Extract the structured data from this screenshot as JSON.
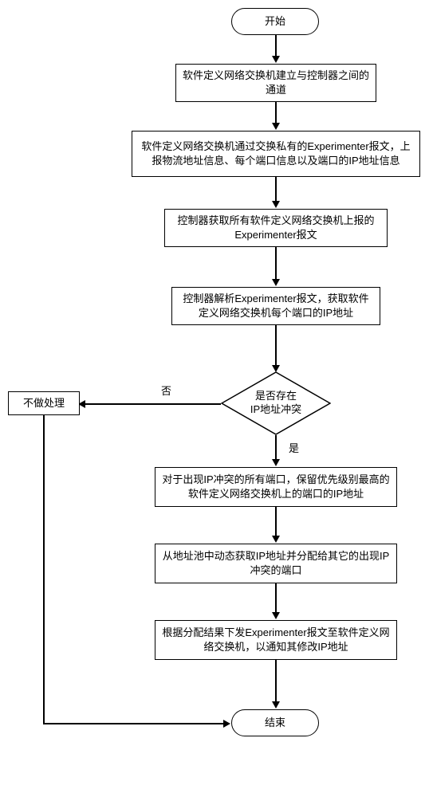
{
  "chart_data": {
    "type": "flowchart",
    "nodes": [
      {
        "id": "start",
        "shape": "terminator",
        "text": "开始"
      },
      {
        "id": "n1",
        "shape": "process",
        "text": "软件定义网络交换机建立与控制器之间的通道"
      },
      {
        "id": "n2",
        "shape": "process",
        "text": "软件定义网络交换机通过交换私有的Experimenter报文，上报物流地址信息、每个端口信息以及端口的IP地址信息"
      },
      {
        "id": "n3",
        "shape": "process",
        "text": "控制器获取所有软件定义网络交换机上报的Experimenter报文"
      },
      {
        "id": "n4",
        "shape": "process",
        "text": "控制器解析Experimenter报文，获取软件定义网络交换机每个端口的IP地址"
      },
      {
        "id": "d1",
        "shape": "decision",
        "text": "是否存在\nIP地址冲突"
      },
      {
        "id": "noop",
        "shape": "process",
        "text": "不做处理"
      },
      {
        "id": "n5",
        "shape": "process",
        "text": "对于出现IP冲突的所有端口，保留优先级别最高的软件定义网络交换机上的端口的IP地址"
      },
      {
        "id": "n6",
        "shape": "process",
        "text": "从地址池中动态获取IP地址并分配给其它的出现IP冲突的端口"
      },
      {
        "id": "n7",
        "shape": "process",
        "text": "根据分配结果下发Experimenter报文至软件定义网络交换机，以通知其修改IP地址"
      },
      {
        "id": "end",
        "shape": "terminator",
        "text": "结束"
      }
    ],
    "edges": [
      {
        "from": "start",
        "to": "n1"
      },
      {
        "from": "n1",
        "to": "n2"
      },
      {
        "from": "n2",
        "to": "n3"
      },
      {
        "from": "n3",
        "to": "n4"
      },
      {
        "from": "n4",
        "to": "d1"
      },
      {
        "from": "d1",
        "to": "noop",
        "label": "否"
      },
      {
        "from": "d1",
        "to": "n5",
        "label": "是"
      },
      {
        "from": "n5",
        "to": "n6"
      },
      {
        "from": "n6",
        "to": "n7"
      },
      {
        "from": "n7",
        "to": "end"
      },
      {
        "from": "noop",
        "to": "end"
      }
    ],
    "edge_labels": {
      "no": "否",
      "yes": "是"
    }
  }
}
